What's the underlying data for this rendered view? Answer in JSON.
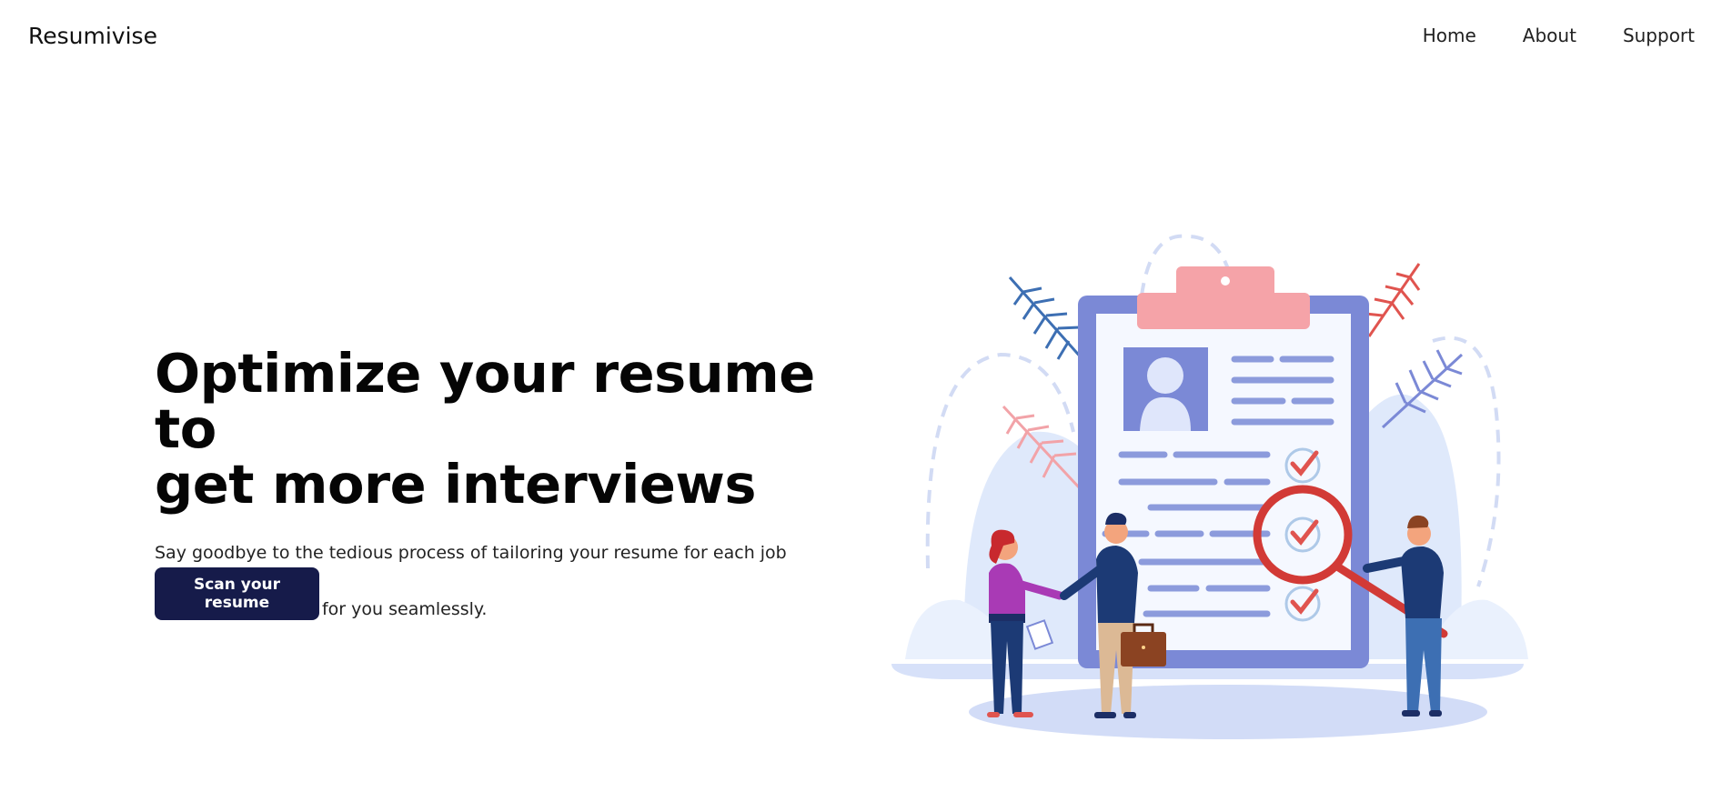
{
  "header": {
    "brand": "Resumivise",
    "nav": [
      {
        "label": "Home"
      },
      {
        "label": "About"
      },
      {
        "label": "Support"
      }
    ]
  },
  "hero": {
    "title_line1": "Optimize your resume to",
    "title_line2": "get more interviews",
    "subtitle_line1": "Say goodbye to the tedious process of tailoring your resume for each job application;",
    "subtitle_line2": "Resumivise does it for you seamlessly.",
    "cta_label": "Scan your resume"
  },
  "colors": {
    "cta_background": "#161b4a",
    "clipboard": "#7b89d6",
    "clip": "#f5a3a8",
    "check": "#e0544f",
    "magnifier": "#d23a36"
  },
  "illustration": {
    "description_icons": [
      "clipboard-icon",
      "magnifier-icon",
      "checkmark-icon",
      "avatar-icon",
      "leaf-icon",
      "briefcase-icon"
    ]
  }
}
